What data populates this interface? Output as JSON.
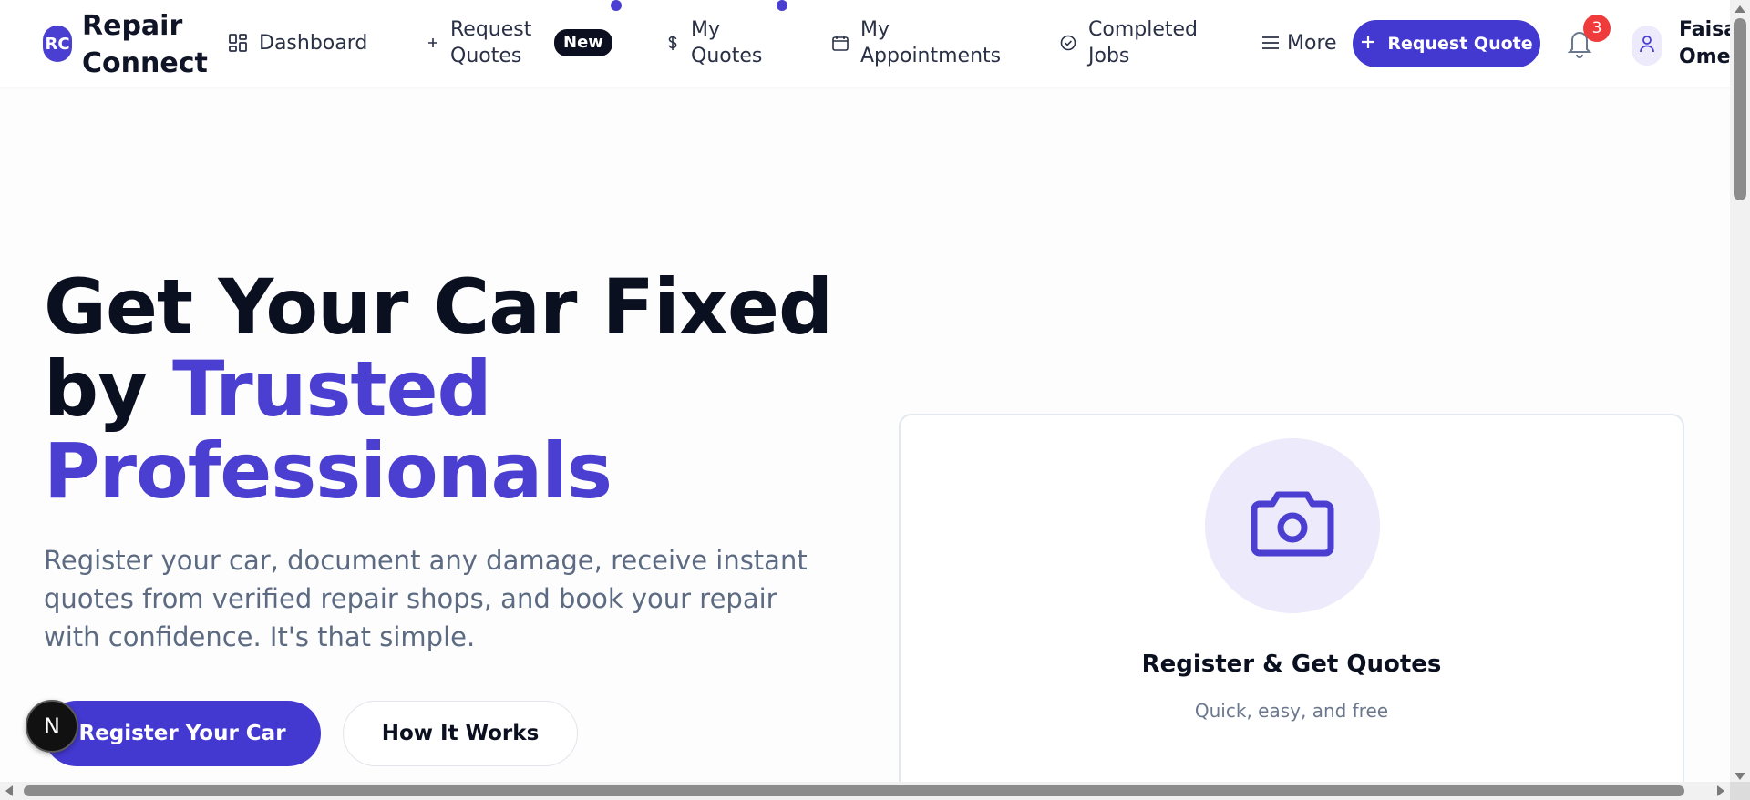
{
  "header": {
    "logo_initials": "RC",
    "logo_text": "Repair Connect",
    "nav": [
      {
        "label": "Dashboard",
        "icon": "grid-icon"
      },
      {
        "label": "Request Quotes",
        "icon": "plus-icon",
        "badge": "New"
      },
      {
        "label": "My Quotes",
        "icon": "dollar-icon"
      },
      {
        "label": "My Appointments",
        "icon": "calendar-icon"
      },
      {
        "label": "Completed Jobs",
        "icon": "check-circle-icon"
      },
      {
        "label": "More",
        "icon": "menu-icon"
      }
    ],
    "request_quote_label": "Request Quote",
    "notification_count": "3",
    "user_name": "Faisal Omer"
  },
  "hero": {
    "title_line1": "Get Your Car Fixed",
    "title_by": "by ",
    "title_accent": "Trusted Professionals",
    "description": "Register your car, document any damage, receive instant quotes from verified repair shops, and book your repair with confidence. It's that simple.",
    "primary_button": "Register Your Car",
    "secondary_button": "How It Works"
  },
  "card": {
    "icon": "camera-icon",
    "title": "Register & Get Quotes",
    "subtitle": "Quick, easy, and free"
  },
  "dev_badge": "N",
  "colors": {
    "accent": "#4b3fd1",
    "button": "#4338d0",
    "notification": "#ef3b3b",
    "muted_text": "#5d6b82"
  }
}
